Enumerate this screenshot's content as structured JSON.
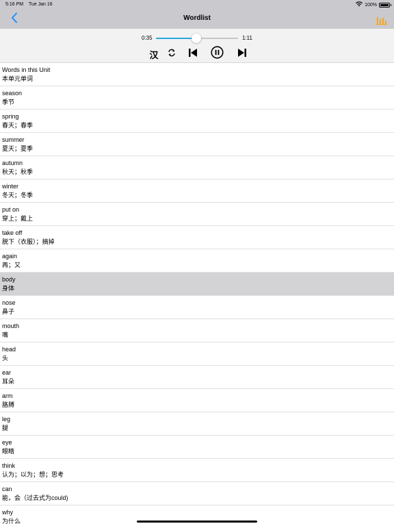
{
  "status": {
    "time": "5:16 PM",
    "date": "Tue Jan 16",
    "battery": "100%",
    "wifi_icon": "wifi-icon",
    "battery_icon": "battery-icon"
  },
  "nav": {
    "title": "Wordlist",
    "back_icon": "chevron-left-icon",
    "chart_icon": "bar-chart-icon",
    "accent_color": "#1e90ff",
    "chart_color": "#f5a623"
  },
  "player": {
    "current_time": "0:35",
    "total_time": "1:11",
    "progress": 0.49,
    "progress_color": "#2aa7e0",
    "han_label": "汉",
    "repeat_icon": "repeat-icon",
    "previous_icon": "skip-previous-icon",
    "pause_icon": "pause-icon",
    "next_icon": "skip-next-icon"
  },
  "words": [
    {
      "en": "Words in this Unit",
      "zh": "本单元单词",
      "selected": false
    },
    {
      "en": "season",
      "zh": "季节",
      "selected": false
    },
    {
      "en": "spring",
      "zh": "春天；春季",
      "selected": false
    },
    {
      "en": "summer",
      "zh": "夏天；夏季",
      "selected": false
    },
    {
      "en": "autumn",
      "zh": "秋天；秋季",
      "selected": false
    },
    {
      "en": "winter",
      "zh": "冬天；冬季",
      "selected": false
    },
    {
      "en": "put on",
      "zh": "穿上；戴上",
      "selected": false
    },
    {
      "en": "take off",
      "zh": "脱下（衣服）；摘掉",
      "selected": false
    },
    {
      "en": "again",
      "zh": "再；又",
      "selected": false
    },
    {
      "en": "body",
      "zh": "身体",
      "selected": true
    },
    {
      "en": "nose",
      "zh": "鼻子",
      "selected": false
    },
    {
      "en": "mouth",
      "zh": "嘴",
      "selected": false
    },
    {
      "en": "head",
      "zh": "头",
      "selected": false
    },
    {
      "en": "ear",
      "zh": "耳朵",
      "selected": false
    },
    {
      "en": "arm",
      "zh": "胳膊",
      "selected": false
    },
    {
      "en": "leg",
      "zh": "腿",
      "selected": false
    },
    {
      "en": "eye",
      "zh": "眼睛",
      "selected": false
    },
    {
      "en": "think",
      "zh": "认为；以为；想；思考",
      "selected": false
    },
    {
      "en": "can",
      "zh": "能，会（过去式为could)",
      "selected": false
    },
    {
      "en": "why",
      "zh": "为什么",
      "selected": false
    }
  ]
}
